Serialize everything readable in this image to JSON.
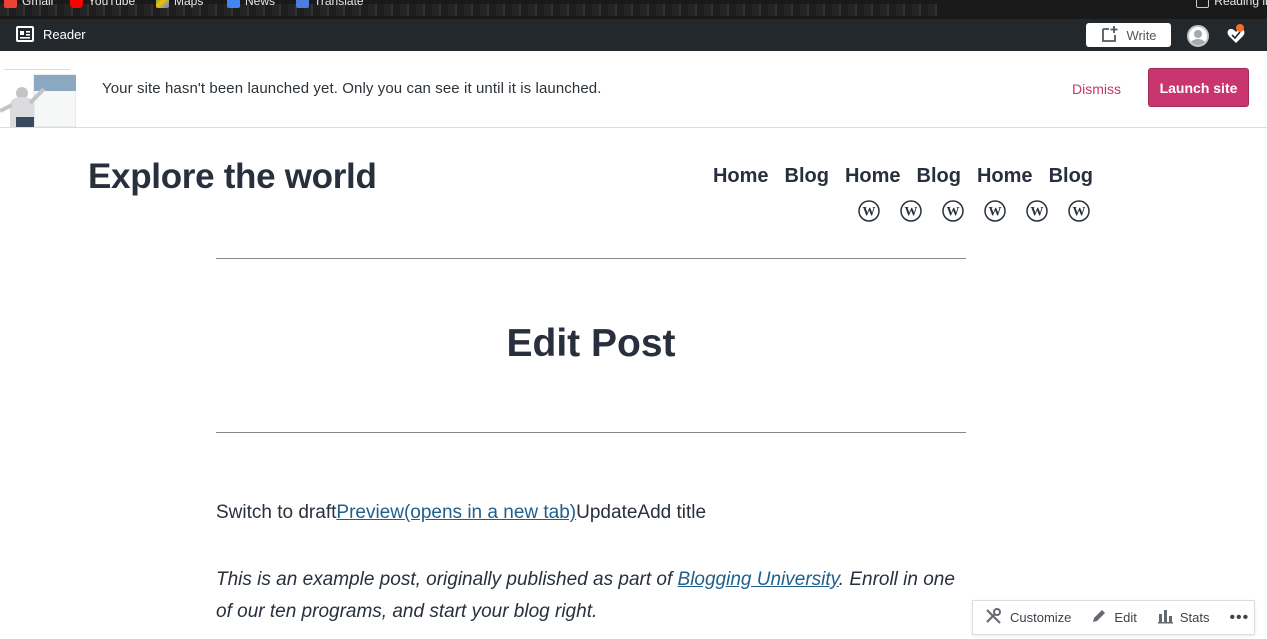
{
  "browser": {
    "bookmarks": [
      "Gmail",
      "YouTube",
      "Maps",
      "News",
      "Translate"
    ],
    "reading_list": "Reading list"
  },
  "adminbar": {
    "reader_label": "Reader",
    "write_label": "Write"
  },
  "banner": {
    "message": "Your site hasn't been launched yet. Only you can see it until it is launched.",
    "dismiss_label": "Dismiss",
    "launch_label": "Launch site"
  },
  "site": {
    "title": "Explore the world",
    "menu": [
      "Home",
      "Blog",
      "Home",
      "Blog",
      "Home",
      "Blog"
    ],
    "social_icons": [
      "wordpress-icon",
      "wordpress-icon",
      "wordpress-icon",
      "wordpress-icon",
      "wordpress-icon",
      "wordpress-icon"
    ]
  },
  "page": {
    "title": "Edit Post",
    "actions": {
      "switch_to_draft": "Switch to draft",
      "preview": "Preview(opens in a new tab)",
      "update": "Update",
      "add_title": "Add title"
    },
    "excerpt": {
      "before": "This is an example post, originally published as part of ",
      "link": "Blogging University",
      "after": ". Enroll in one of our ten programs, and start your blog right."
    }
  },
  "floating_bar": {
    "customize_label": "Customize",
    "edit_label": "Edit",
    "stats_label": "Stats",
    "more_label": "•••"
  },
  "colors": {
    "admin_bar": "#23282d",
    "accent_pink": "#c9356e",
    "link_blue": "#1f5f8b",
    "text_dark": "#28303d"
  }
}
